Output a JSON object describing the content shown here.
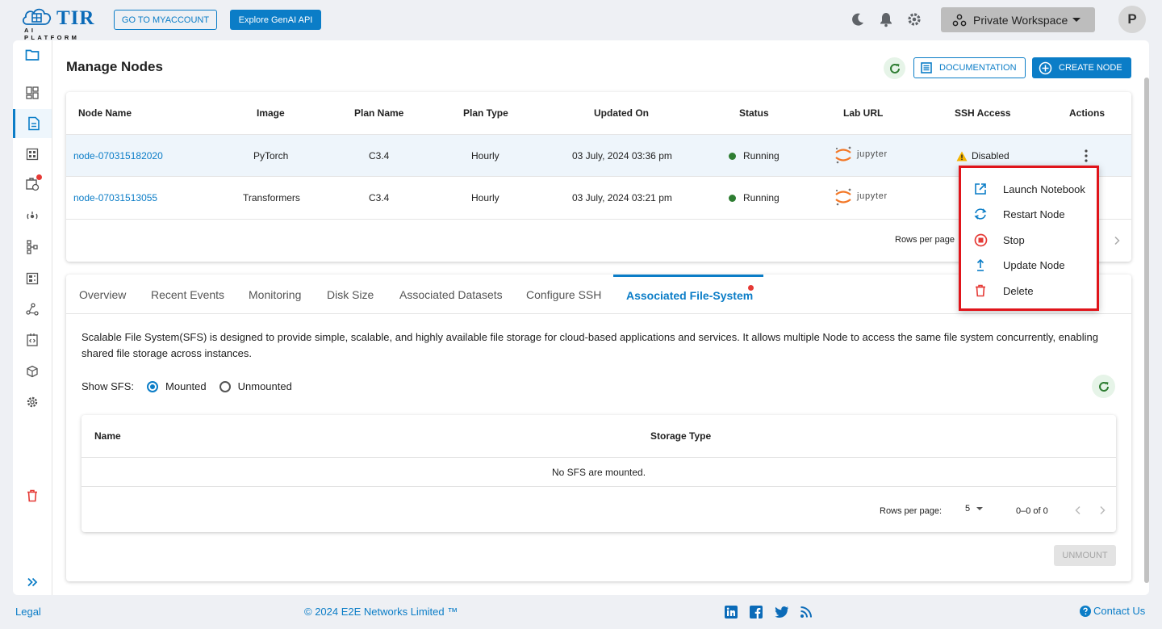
{
  "app": {
    "logo_text": "TIR",
    "logo_sub": "AI PLATFORM",
    "myaccount_label": "GO TO MYACCOUNT",
    "genai_label": "Explore GenAI API",
    "workspace_label": "Private Workspace",
    "avatar_initial": "P"
  },
  "page": {
    "title": "Manage Nodes",
    "documentation_label": "DOCUMENTATION",
    "create_label": "CREATE NODE"
  },
  "nodes_table": {
    "headers": [
      "Node Name",
      "Image",
      "Plan Name",
      "Plan Type",
      "Updated On",
      "Status",
      "Lab URL",
      "SSH Access",
      "Actions"
    ],
    "rows": [
      {
        "name": "node-070315182020",
        "image": "PyTorch",
        "plan": "C3.4",
        "plan_type": "Hourly",
        "updated": "03 July, 2024 03:36 pm",
        "status": "Running",
        "lab": "jupyter",
        "ssh": "Disabled"
      },
      {
        "name": "node-07031513055",
        "image": "Transformers",
        "plan": "C3.4",
        "plan_type": "Hourly",
        "updated": "03 July, 2024 03:21 pm",
        "status": "Running",
        "lab": "jupyter",
        "ssh": ""
      }
    ],
    "rows_per_page_label": "Rows per page"
  },
  "actions_menu": {
    "items": [
      "Launch Notebook",
      "Restart Node",
      "Stop",
      "Update Node",
      "Delete"
    ]
  },
  "tabs": {
    "items": [
      "Overview",
      "Recent Events",
      "Monitoring",
      "Disk Size",
      "Associated Datasets",
      "Configure SSH",
      "Associated File-System"
    ],
    "active": "Associated File-System"
  },
  "sfs": {
    "description": "Scalable File System(SFS) is designed to provide simple, scalable, and highly available file storage for cloud-based applications and services. It allows multiple Node to access the same file system concurrently, enabling shared file storage across instances.",
    "show_label": "Show SFS:",
    "option_mounted": "Mounted",
    "option_unmounted": "Unmounted",
    "selected": "Mounted",
    "headers": [
      "Name",
      "Storage Type"
    ],
    "empty_text": "No SFS are mounted.",
    "rows_per_page_label": "Rows per page:",
    "rows_per_page_value": "5",
    "range_text": "0–0 of 0",
    "unmount_label": "UNMOUNT"
  },
  "footer": {
    "legal": "Legal",
    "copyright": "© 2024 E2E Networks Limited ™",
    "contact": "Contact Us"
  },
  "colors": {
    "accent": "#0b7dc7",
    "running": "#2e7d32",
    "danger": "#e53935",
    "highlight_border": "#e0141a"
  }
}
